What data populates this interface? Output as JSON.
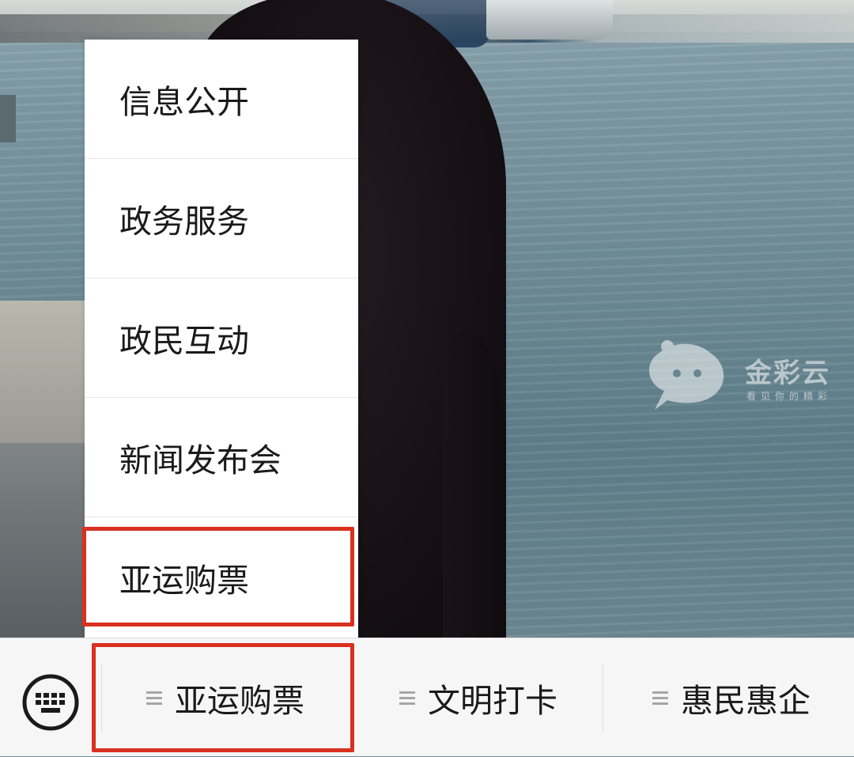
{
  "watermark": {
    "name": "金彩云",
    "slogan": "看见你的精彩"
  },
  "submenu": {
    "items": [
      {
        "label": "信息公开"
      },
      {
        "label": "政务服务"
      },
      {
        "label": "政民互动"
      },
      {
        "label": "新闻发布会"
      },
      {
        "label": "亚运购票"
      }
    ]
  },
  "bottom_bar": {
    "keyboard_icon": "keyboard-icon",
    "tabs": [
      {
        "label": "亚运购票"
      },
      {
        "label": "文明打卡"
      },
      {
        "label": "惠民惠企"
      }
    ]
  },
  "colors": {
    "highlight": "#d9301f",
    "bar_background": "#f6f6f6",
    "text": "#1a1a1a"
  }
}
